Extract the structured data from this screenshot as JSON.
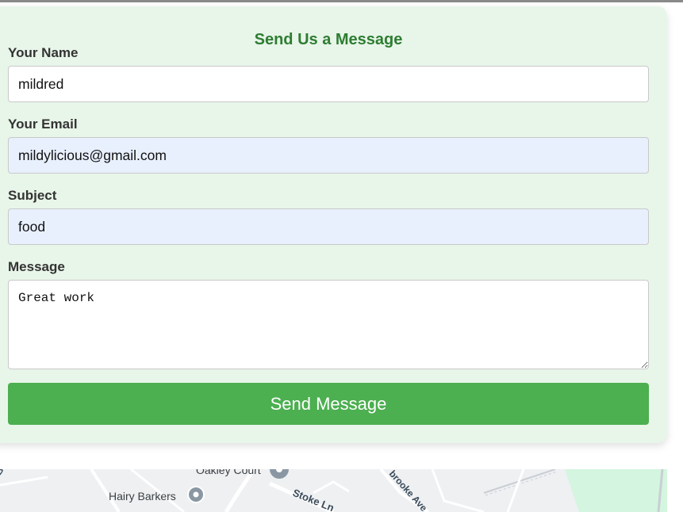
{
  "form": {
    "title": "Send Us a Message",
    "name_label": "Your Name",
    "name_value": "mildred",
    "email_label": "Your Email",
    "email_value": "mildylicious@gmail.com",
    "subject_label": "Subject",
    "subject_value": "food",
    "message_label": "Message",
    "message_value": "Great work",
    "submit_label": "Send Message"
  },
  "map": {
    "places": {
      "oakley_court": "Oakley Court",
      "hairy_barkers": "Hairy Barkers"
    },
    "roads": {
      "stoke_ln": "Stoke Ln",
      "brooke_ave": "brooke Ave",
      "edge_fragment": "B"
    }
  },
  "colors": {
    "card_background": "#e8f5e9",
    "title_color": "#2e7d32",
    "button_color": "#4caf50",
    "autofill_background": "#e8f0fe",
    "map_park": "#d4f5df"
  },
  "icons": {
    "map_pin": "map-pin-icon",
    "resize_handle": "resize-handle-icon"
  }
}
